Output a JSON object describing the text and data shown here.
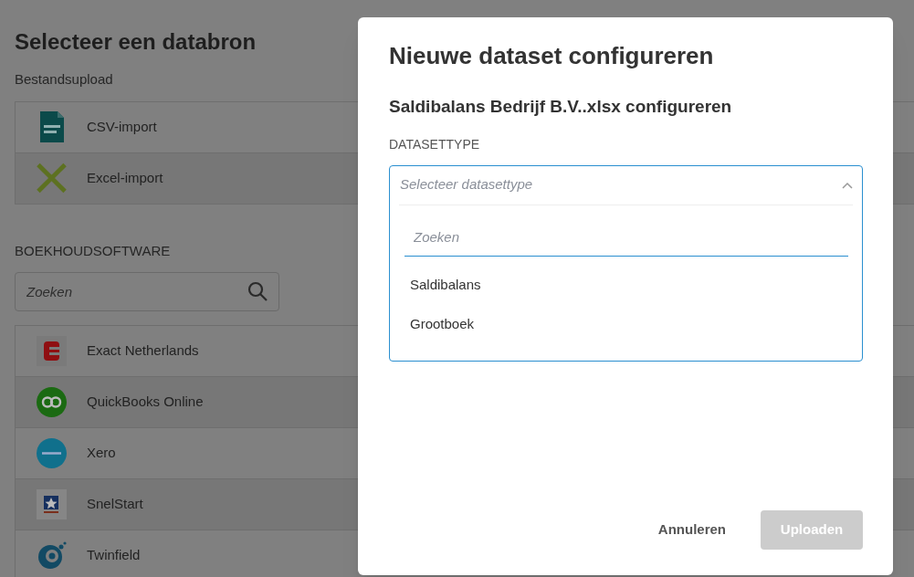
{
  "page": {
    "title": "Selecteer een databron",
    "file_upload": {
      "heading": "Bestandsupload",
      "items": [
        {
          "label": "CSV-import",
          "kind": "csv"
        },
        {
          "label": "Excel-import",
          "kind": "excel"
        }
      ]
    },
    "accounting": {
      "heading": "BOEKHOUDSOFTWARE",
      "search": {
        "placeholder": "Zoeken"
      },
      "items": [
        {
          "label": "Exact Netherlands",
          "kind": "exact"
        },
        {
          "label": "QuickBooks Online",
          "kind": "quickbooks"
        },
        {
          "label": "Xero",
          "kind": "xero"
        },
        {
          "label": "SnelStart",
          "kind": "snelstart"
        },
        {
          "label": "Twinfield",
          "kind": "twinfield"
        }
      ]
    }
  },
  "dialog": {
    "title": "Nieuwe dataset configureren",
    "subtitle": "Saldibalans Bedrijf B.V..xlsx configureren",
    "field_label": "DATASETTYPE",
    "select": {
      "placeholder": "Selecteer datasettype",
      "expanded": true,
      "search": {
        "placeholder": "Zoeken"
      },
      "options": [
        {
          "label": "Saldibalans"
        },
        {
          "label": "Grootboek"
        }
      ]
    },
    "buttons": [
      {
        "label": "Annuleren",
        "kind": "text",
        "disabled": false
      },
      {
        "label": "Uploaden",
        "kind": "primary",
        "disabled": true
      }
    ]
  }
}
